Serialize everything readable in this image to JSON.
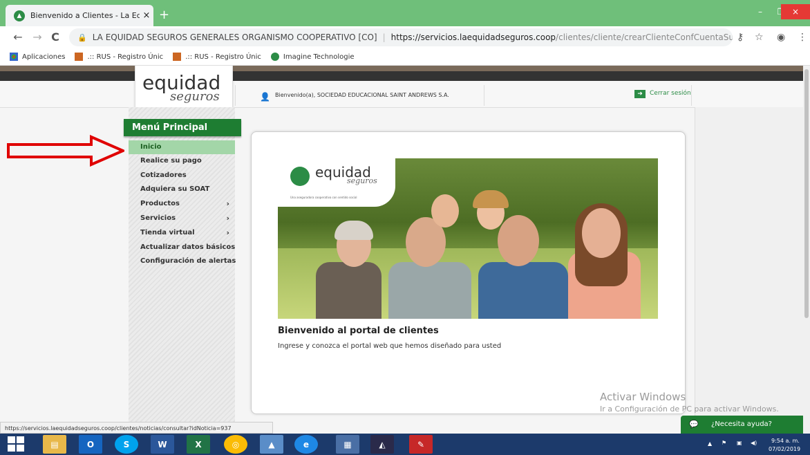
{
  "browser": {
    "tab_title": "Bienvenido a Clientes - La Equida",
    "tab_close": "×",
    "new_tab": "+",
    "window_controls": {
      "minimize": "–",
      "restore": "❐",
      "close": "×"
    },
    "nav": {
      "back": "←",
      "forward": "→",
      "reload": "C"
    },
    "omnibox": {
      "org": "LA EQUIDAD SEGUROS GENERALES ORGANISMO COOPERATIVO [CO]",
      "url_base": "https://servicios.laequidadseguros.coop",
      "url_path": "/clientes/cliente/crearClienteConfCuentaSubmit"
    },
    "bookmarks": [
      {
        "label": "Aplicaciones",
        "icon": "apps-icon"
      },
      {
        "label": ".:: RUS - Registro Únic",
        "icon": "rus-icon"
      },
      {
        "label": ".:: RUS - Registro Únic",
        "icon": "rus-icon"
      },
      {
        "label": "Imagine Technologie",
        "icon": "imagine-icon"
      }
    ]
  },
  "site": {
    "logo": {
      "main": "equidad",
      "sub": "seguros"
    },
    "welcome": "Bienvenido(a), SOCIEDAD EDUCACIONAL SAINT ANDREWS S.A.",
    "logout": "Cerrar sesión"
  },
  "menu": {
    "title": "Menú Principal",
    "items": [
      {
        "label": "Inicio",
        "active": true,
        "submenu": false
      },
      {
        "label": "Realice su pago",
        "active": false,
        "submenu": false
      },
      {
        "label": "Cotizadores",
        "active": false,
        "submenu": false
      },
      {
        "label": "Adquiera su SOAT",
        "active": false,
        "submenu": false
      },
      {
        "label": "Productos",
        "active": false,
        "submenu": true
      },
      {
        "label": "Servicios",
        "active": false,
        "submenu": true
      },
      {
        "label": "Tienda virtual",
        "active": false,
        "submenu": true
      },
      {
        "label": "Actualizar datos básicos",
        "active": false,
        "submenu": false
      },
      {
        "label": "Configuración de alertas",
        "active": false,
        "submenu": false
      }
    ],
    "chevron": "›"
  },
  "banner": {
    "logo": "equidad",
    "logo_sub": "seguros",
    "tagline": "Una aseguradora cooperativa con sentido social"
  },
  "content": {
    "title": "Bienvenido al portal de clientes",
    "text": "Ingrese y conozca el portal web que hemos diseñado para usted"
  },
  "watermark": {
    "line1": "Activar Windows",
    "line2": "Ir a Configuración de PC para activar Windows."
  },
  "status_url": "https://servicios.laequidadseguros.coop/clientes/noticias/consultar?idNoticia=937",
  "help_button": "¿Necesita ayuda?",
  "taskbar": {
    "time": "9:54 a. m.",
    "date": "07/02/2019"
  },
  "colors": {
    "brand_green": "#1e7d32",
    "active_item": "#a3d6a8",
    "arrow": "#e00000"
  }
}
